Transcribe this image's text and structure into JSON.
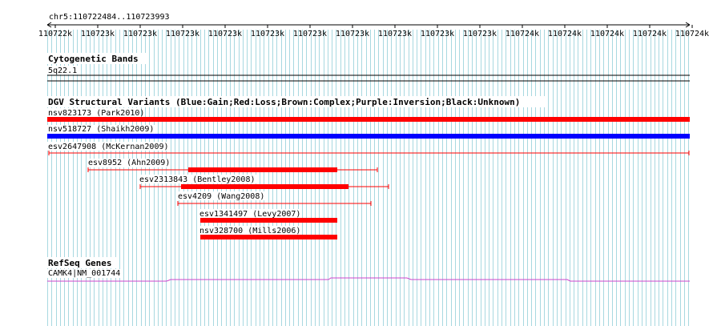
{
  "ruler": {
    "location": "chr5:110722484..110723993",
    "ticks": [
      "110722k",
      "110723k",
      "110723k",
      "110723k",
      "110723k",
      "110723k",
      "110723k",
      "110723k",
      "110723k",
      "110723k",
      "110723k",
      "110724k",
      "110724k",
      "110724k",
      "110724k",
      "110724k"
    ]
  },
  "tracks": {
    "cytoband": {
      "title": "Cytogenetic Bands",
      "band": "5q22.1"
    },
    "dgv": {
      "title": "DGV Structural Variants (Blue:Gain;Red:Loss;Brown:Complex;Purple:Inversion;Black:Unknown)",
      "features": [
        {
          "label": "nsv823173 (Park2010)",
          "type": "loss"
        },
        {
          "label": "nsv518727 (Shaikh2009)",
          "type": "gain"
        },
        {
          "label": "esv2647908 (McKernan2009)",
          "type": "loss"
        },
        {
          "label": "esv8952 (Ahn2009)",
          "type": "loss"
        },
        {
          "label": "esv2313843 (Bentley2008)",
          "type": "loss"
        },
        {
          "label": "esv4209 (Wang2008)",
          "type": "loss"
        },
        {
          "label": "esv1341497 (Levy2007)",
          "type": "loss"
        },
        {
          "label": "nsv328700 (Mills2006)",
          "type": "loss"
        }
      ]
    },
    "refseq": {
      "title": "RefSeq Genes",
      "gene": "CAMK4|NM_001744"
    }
  },
  "colors": {
    "loss": "#ff0000",
    "gain": "#0000ff",
    "grid": "#a8d8e0",
    "gene": "#cc44cc",
    "text": "#000000"
  }
}
